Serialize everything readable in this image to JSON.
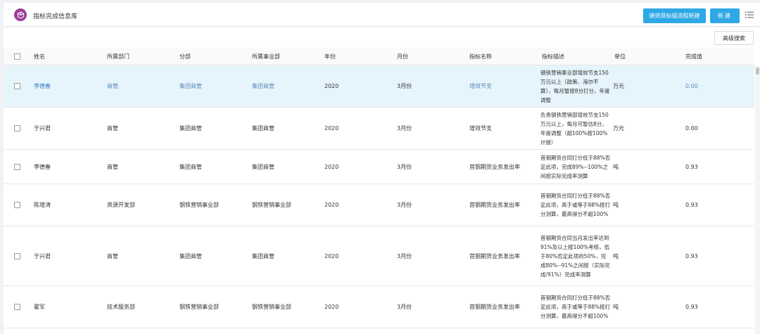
{
  "header": {
    "title": "指标完成信息库",
    "workflow_button": "绩效目标插流程新建",
    "new_button": "新建",
    "logo_icon": "cube-icon",
    "list_icon": "list-icon"
  },
  "toolbar": {
    "advanced_search": "高级搜索"
  },
  "table": {
    "columns": [
      "姓名",
      "所属部门",
      "分部",
      "所属事业部",
      "年份",
      "月份",
      "指标名称",
      "指标描述",
      "单位",
      "完成值"
    ],
    "rows": [
      {
        "name": "李德春",
        "dept": "商管",
        "branch": "集团商管",
        "bu": "集团商管",
        "year": "2020",
        "month": "3月份",
        "metric": "增效节支",
        "desc": "钢铁营销事业部增效节支150万元以上（政策、海尔不算），每月暂按8分打分，年度调整",
        "unit": "万元",
        "value": "0.00"
      },
      {
        "name": "于兴君",
        "dept": "商管",
        "branch": "集团商管",
        "bu": "集团商管",
        "year": "2020",
        "month": "3月份",
        "metric": "增效节支",
        "desc": "负责钢铁营销部增效节支150万元以上，每月可暂估8分，年度调整（超100%按100%计提）",
        "unit": "万元",
        "value": "0.00"
      },
      {
        "name": "李德春",
        "dept": "商管",
        "branch": "集团商管",
        "bu": "集团商管",
        "year": "2020",
        "month": "3月份",
        "metric": "首钢期货业务发出率",
        "desc": "首钢期货合同打分低于88%否定此项，完成89%--100%之间按实际完成率测算",
        "unit": "吨",
        "value": "0.93"
      },
      {
        "name": "陈增涛",
        "dept": "资源开发部",
        "branch": "钢铁营销事业部",
        "bu": "钢铁营销事业部",
        "year": "2020",
        "month": "3月份",
        "metric": "首钢期货业务发出率",
        "desc": "首钢期货合同打分低于88%否定此项，高于或等于88%按打分测算，最高得分不超100%",
        "unit": "吨",
        "value": "0.93"
      },
      {
        "name": "于兴君",
        "dept": "商管",
        "branch": "集团商管",
        "bu": "集团商管",
        "year": "2020",
        "month": "3月份",
        "metric": "首钢期货业务发出率",
        "desc": "首钢期货合同当月发出率达到91%及以上按100%考核，低于80%否定此项的50%，完成80%--91%之间按（实际完成/91%）完成率测算",
        "unit": "吨",
        "value": "0.93"
      },
      {
        "name": "翟军",
        "dept": "技术服务部",
        "branch": "钢铁营销事业部",
        "bu": "钢铁营销事业部",
        "year": "2020",
        "month": "3月份",
        "metric": "首钢期货业务发出率",
        "desc": "首钢期货合同打分低于88%否定此项，高于或等于88%按打分测算，最高得分不超100%",
        "unit": "吨",
        "value": "0.93"
      }
    ]
  }
}
